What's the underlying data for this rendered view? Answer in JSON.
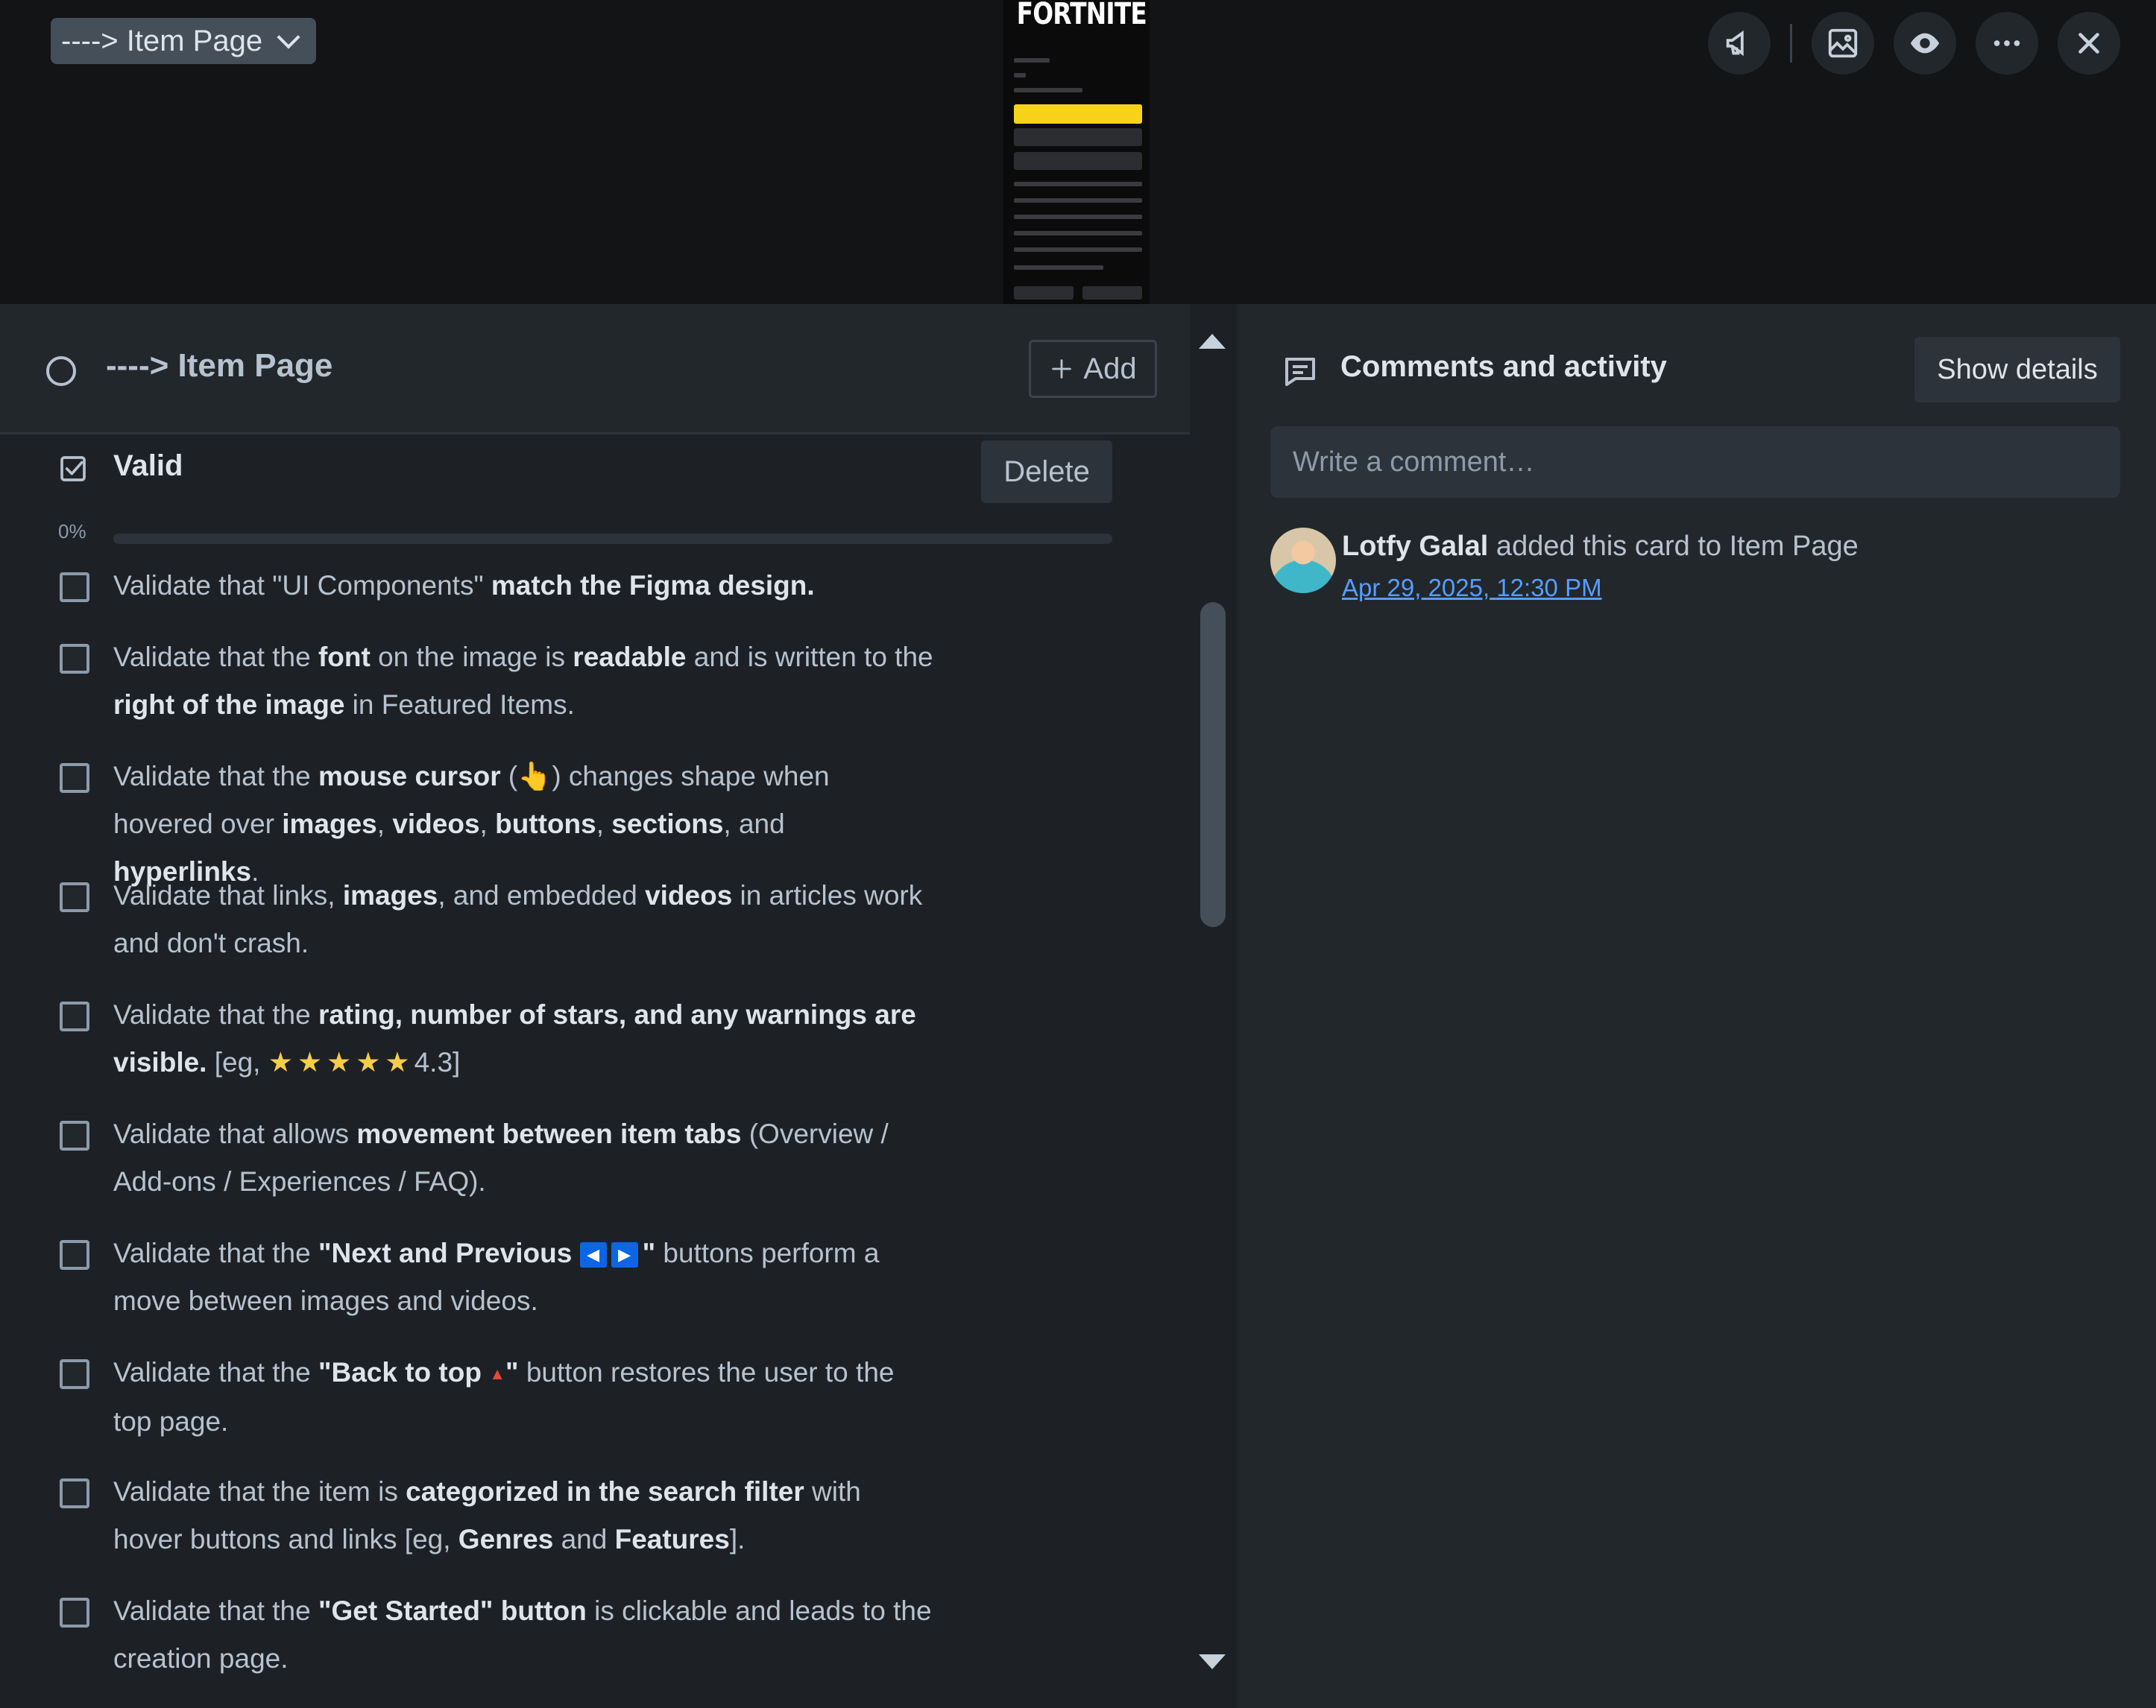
{
  "cover": {
    "list_chip": "----> Item Page",
    "thumbnail_logo": "FORTNITE",
    "actions": [
      "megaphone-icon",
      "image-icon",
      "eye-icon",
      "more-icon",
      "close-icon"
    ]
  },
  "checklist": {
    "title": "----> Item Page",
    "add_label": "Add",
    "section_title": "Valid",
    "delete_label": "Delete",
    "progress_text": "0%",
    "progress_value": 0,
    "items": [
      [
        "Validate that \"UI Components\" ",
        {
          "b": "match the Figma design."
        }
      ],
      [
        "Validate that the ",
        {
          "b": "font"
        },
        " on the image is ",
        {
          "b": "readable"
        },
        " and is written to the ",
        {
          "b": "right of the image"
        },
        " in Featured Items."
      ],
      [
        "Validate that the ",
        {
          "b": "mouse cursor"
        },
        " (👆) changes shape when hovered over ",
        {
          "b": "images"
        },
        ", ",
        {
          "b": "videos"
        },
        ", ",
        {
          "b": "buttons"
        },
        ", ",
        {
          "b": "sections"
        },
        ", and ",
        {
          "b": "hyperlinks"
        },
        "."
      ],
      [
        "Validate that links, ",
        {
          "b": "images"
        },
        ", and embedded ",
        {
          "b": "videos"
        },
        " in articles work and don't crash."
      ],
      [
        "Validate that the ",
        {
          "b": "rating, number of stars, and any warnings are visible."
        },
        " [eg, ",
        {
          "stars": 5
        },
        "4.3]"
      ],
      [
        "Validate that allows ",
        {
          "b": "movement between item tabs"
        },
        " (Overview / Add-ons / Experiences / FAQ)."
      ],
      [
        "Validate that the ",
        {
          "b": "\"Next and Previous "
        },
        {
          "arrows": [
            "◀",
            "▶"
          ]
        },
        {
          "b": "\""
        },
        " buttons perform a move between images and videos."
      ],
      [
        "Validate that the ",
        {
          "b": "\"Back to top "
        },
        {
          "up": "🔺"
        },
        {
          "b": "\""
        },
        " button restores the user to the top page."
      ],
      [
        "Validate that the item is ",
        {
          "b": "categorized in the search filter"
        },
        " with hover buttons and links [eg, ",
        {
          "b": "Genres"
        },
        " and ",
        {
          "b": "Features"
        },
        "]."
      ],
      [
        "Validate that the ",
        {
          "b": "\"Get Started\" button"
        },
        " is clickable and leads to the creation page."
      ]
    ]
  },
  "activity": {
    "title": "Comments and activity",
    "show_details": "Show details",
    "comment_placeholder": "Write a comment…",
    "entries": [
      {
        "user": "Lotfy Galal",
        "text": " added this card to Item Page",
        "date": "Apr 29, 2025, 12:30 PM"
      }
    ]
  },
  "colors": {
    "accent": "#579dff",
    "star": "#f5cd47",
    "background": "#1d2125"
  }
}
